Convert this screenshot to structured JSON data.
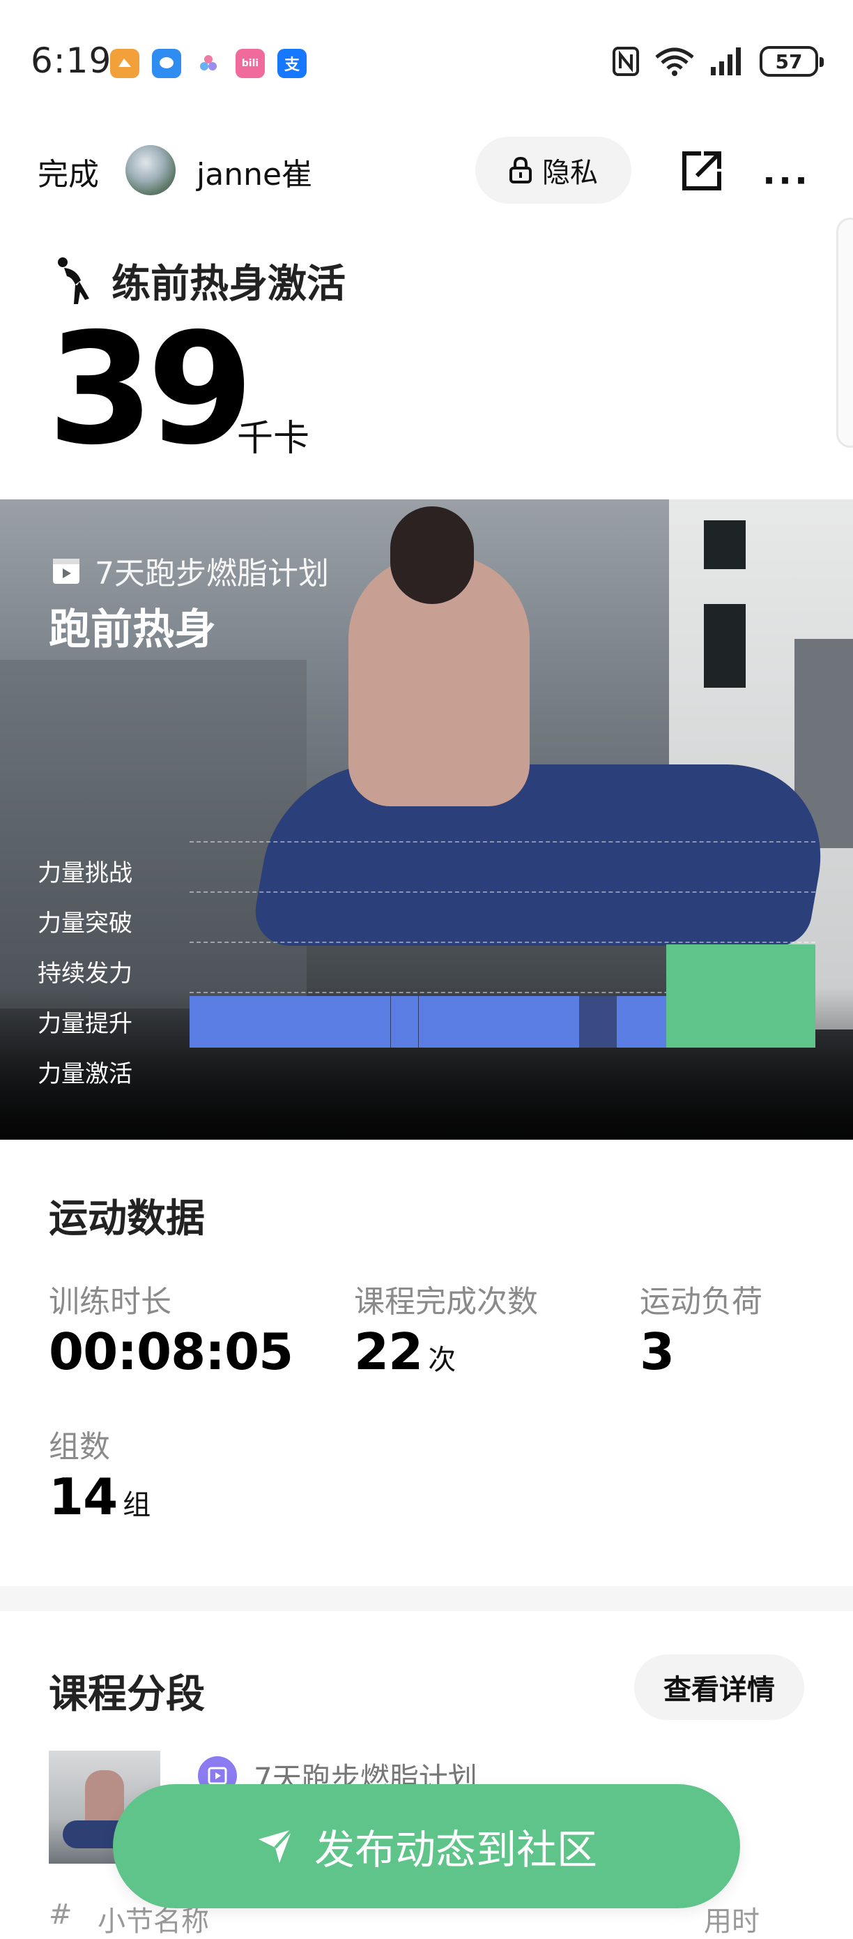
{
  "status_bar": {
    "time": "6:19",
    "notification_icons": [
      "wallet-app-icon",
      "chat-app-icon",
      "photos-app-icon",
      "bilibili-icon",
      "alipay-icon"
    ],
    "notification_badges": [
      "",
      "",
      "",
      "bili",
      "支"
    ],
    "system_icons": [
      "nfc-icon",
      "wifi-icon",
      "signal-icon"
    ],
    "battery": "57"
  },
  "header": {
    "done_label": "完成",
    "username": "janne崔",
    "privacy_label": "隐私",
    "more_label": "···"
  },
  "workout": {
    "title": "练前热身激活",
    "calories_value": "39",
    "calories_unit": "千卡"
  },
  "hero": {
    "plan_name": "7天跑步燃脂计划",
    "session_title": "跑前热身"
  },
  "chart_data": {
    "type": "bar",
    "y_levels": [
      "力量挑战",
      "力量突破",
      "持续发力",
      "力量提升",
      "力量激活"
    ],
    "segments": [
      {
        "start": 0.0,
        "end": 0.322,
        "level": 1,
        "color": "#5b7ee5"
      },
      {
        "start": 0.322,
        "end": 0.366,
        "level": 1,
        "color": "#5b7ee5"
      },
      {
        "start": 0.366,
        "end": 0.622,
        "level": 1,
        "color": "#5b7ee5"
      },
      {
        "start": 0.622,
        "end": 0.683,
        "level": 1,
        "color": "#3a4a82"
      },
      {
        "start": 0.683,
        "end": 0.762,
        "level": 1,
        "color": "#5b7ee5"
      },
      {
        "start": 0.762,
        "end": 1.0,
        "level": 2,
        "color": "#5ec48a"
      }
    ],
    "grid": true
  },
  "stats": {
    "section_title": "运动数据",
    "items": [
      {
        "label": "训练时长",
        "value": "00:08:05",
        "unit": ""
      },
      {
        "label": "课程完成次数",
        "value": "22",
        "unit": "次"
      },
      {
        "label": "运动负荷",
        "value": "3",
        "unit": ""
      },
      {
        "label": "组数",
        "value": "14",
        "unit": "组"
      }
    ]
  },
  "segments": {
    "section_title": "课程分段",
    "details_label": "查看详情",
    "plan_name": "7天跑步燃脂计划",
    "col_index": "#",
    "col_name": "小节名称",
    "col_time": "用时"
  },
  "publish": {
    "label": "发布动态到社区"
  },
  "colors": {
    "accent_green": "#5ec48a",
    "chart_blue": "#5b7ee5",
    "plan_purple": "#8a7bf0"
  }
}
